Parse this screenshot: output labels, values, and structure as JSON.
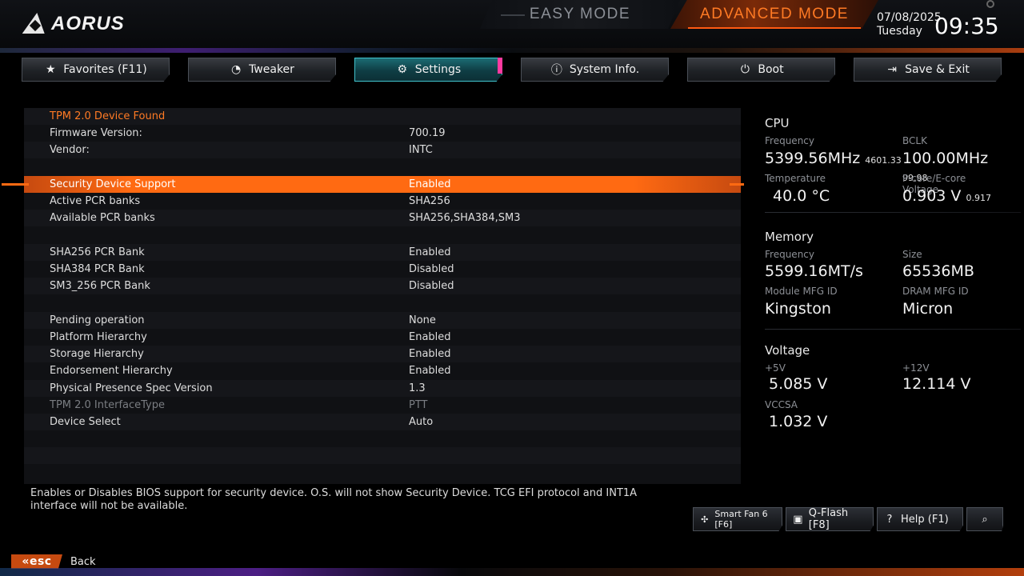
{
  "top": {
    "logo_text": "AORUS",
    "easy_mode": "EASY MODE",
    "advanced_mode": "ADVANCED MODE",
    "date": "07/08/2025",
    "day": "Tuesday",
    "time": "09:35"
  },
  "tabs": [
    {
      "label": "Favorites (F11)",
      "icon": "star-icon"
    },
    {
      "label": "Tweaker",
      "icon": "gauge-icon"
    },
    {
      "label": "Settings",
      "icon": "gear-icon",
      "active": true
    },
    {
      "label": "System Info.",
      "icon": "info-icon"
    },
    {
      "label": "Boot",
      "icon": "power-icon"
    },
    {
      "label": "Save & Exit",
      "icon": "exit-icon"
    }
  ],
  "settings": {
    "header": "TPM 2.0 Device Found",
    "rows": [
      {
        "label": "Firmware Version:",
        "value": "700.19"
      },
      {
        "label": "Vendor:",
        "value": "INTC"
      },
      {
        "label": "",
        "value": ""
      },
      {
        "label": "Security Device Support",
        "value": "Enabled",
        "selected": true
      },
      {
        "label": "Active PCR banks",
        "value": "SHA256"
      },
      {
        "label": "Available PCR banks",
        "value": "SHA256,SHA384,SM3"
      },
      {
        "label": "",
        "value": ""
      },
      {
        "label": "SHA256 PCR Bank",
        "value": "Enabled"
      },
      {
        "label": "SHA384 PCR Bank",
        "value": "Disabled"
      },
      {
        "label": "SM3_256 PCR Bank",
        "value": "Disabled"
      },
      {
        "label": "",
        "value": ""
      },
      {
        "label": "Pending operation",
        "value": "None"
      },
      {
        "label": "Platform Hierarchy",
        "value": "Enabled"
      },
      {
        "label": "Storage Hierarchy",
        "value": "Enabled"
      },
      {
        "label": "Endorsement Hierarchy",
        "value": "Enabled"
      },
      {
        "label": "Physical Presence Spec Version",
        "value": "1.3"
      },
      {
        "label": "TPM 2.0 InterfaceType",
        "value": "PTT",
        "dim": true
      },
      {
        "label": "Device Select",
        "value": "Auto"
      }
    ]
  },
  "help_text": "Enables or Disables BIOS support for security device. O.S. will not show Security Device. TCG EFI protocol and INT1A interface will not be available.",
  "monitor": {
    "cpu": {
      "title": "CPU",
      "frequency_label": "Frequency",
      "frequency": "5399.56MHz",
      "frequency_sub": "4601.33",
      "bclk_label": "BCLK",
      "bclk": "100.00MHz",
      "bclk_sub": "99.98",
      "temp_label": "Temperature",
      "temp": "40.0 °C",
      "voltage_label": "P-core/E-core Voltage",
      "voltage": "0.903 V",
      "voltage_sub": "0.917"
    },
    "memory": {
      "title": "Memory",
      "frequency_label": "Frequency",
      "frequency": "5599.16MT/s",
      "size_label": "Size",
      "size": "65536MB",
      "module_label": "Module MFG ID",
      "module": "Kingston",
      "dram_label": "DRAM MFG ID",
      "dram": "Micron"
    },
    "voltage": {
      "title": "Voltage",
      "v5_label": "+5V",
      "v5": "5.085 V",
      "v12_label": "+12V",
      "v12": "12.114 V",
      "vccsa_label": "VCCSA",
      "vccsa": "1.032 V"
    }
  },
  "bottom": {
    "smart_fan": "Smart Fan 6 [F6]",
    "qflash": "Q-Flash [F8]",
    "help": "Help (F1)",
    "esc": "esc",
    "back": "Back"
  },
  "colors": {
    "accent_orange": "#ff6a12",
    "active_tab": "#1c6e76",
    "header_text": "#ff7a24"
  }
}
